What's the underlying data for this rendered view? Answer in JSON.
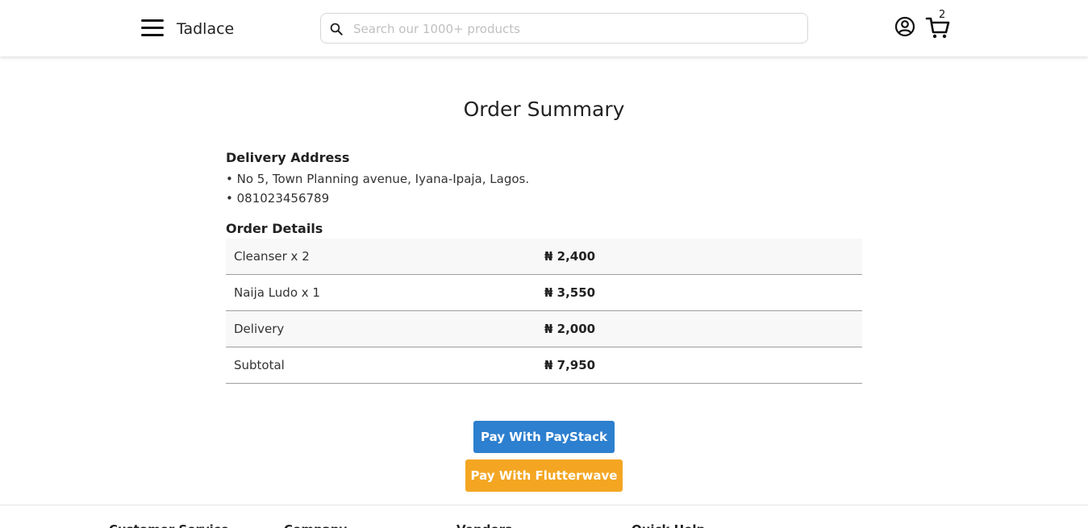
{
  "header": {
    "brand": "Tadlace",
    "search_placeholder": "Search our 1000+ products",
    "cart_count": "2"
  },
  "main": {
    "title": "Order Summary",
    "delivery_address": {
      "heading": "Delivery Address",
      "lines": [
        "• No 5, Town Planning avenue, Iyana-Ipaja, Lagos.",
        "• 081023456789"
      ]
    },
    "order_details": {
      "heading": "Order Details",
      "rows": [
        {
          "item": "Cleanser x 2",
          "amount": "₦ 2,400"
        },
        {
          "item": "Naija Ludo x 1",
          "amount": "₦ 3,550"
        },
        {
          "item": "Delivery",
          "amount": "₦ 2,000"
        },
        {
          "item": "Subtotal",
          "amount": "₦ 7,950"
        }
      ]
    },
    "buttons": {
      "paystack": "Pay With PayStack",
      "flutterwave": "Pay With Flutterwave"
    }
  },
  "footer": {
    "headings": [
      "Customer Service",
      "Company",
      "Vendors",
      "Quick Help"
    ]
  },
  "colors": {
    "paystack_button": "#2d7fcf",
    "flutterwave_button": "#f4a623",
    "row_shade": "#f8f8f8",
    "row_border": "#9e9e9e"
  },
  "icons": {
    "menu": "hamburger-menu-icon",
    "search": "search-icon",
    "account": "user-circle-icon",
    "cart": "shopping-cart-icon"
  }
}
